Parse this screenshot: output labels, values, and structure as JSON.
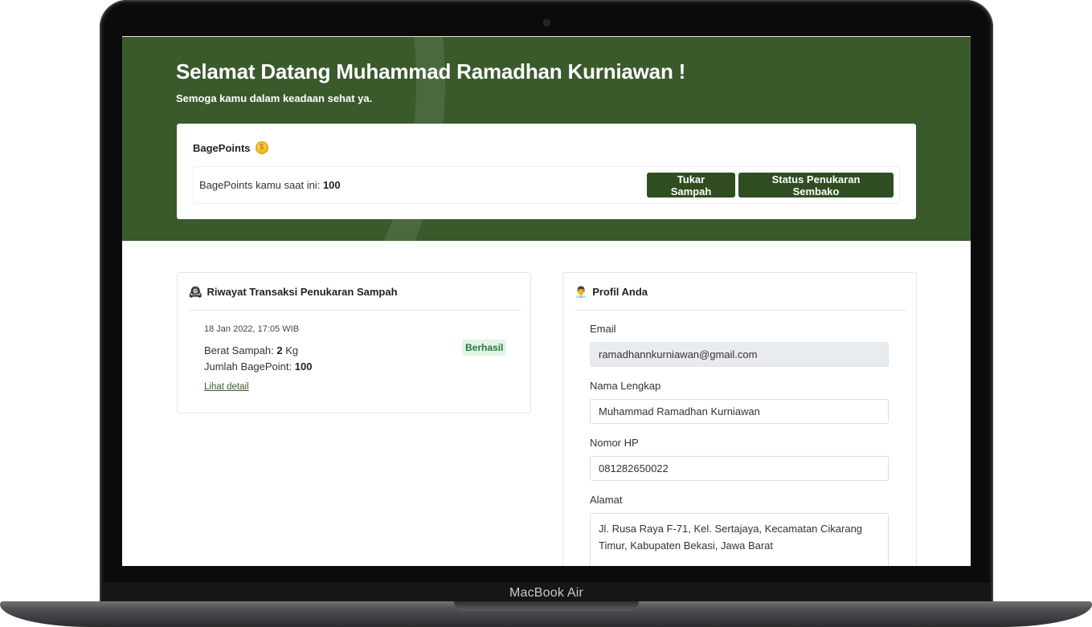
{
  "device": {
    "label": "MacBook Air"
  },
  "hero": {
    "title": "Selamat Datang Muhammad Ramadhan Kurniawan !",
    "subtitle": "Semoga kamu dalam keadaan sehat ya."
  },
  "points": {
    "title": "BagePoints",
    "coin_glyph": "$",
    "label": "BagePoints kamu saat ini:",
    "value": "100",
    "btn_tukar": "Tukar Sampah",
    "btn_status": "Status Penukaran Sembako"
  },
  "riwayat": {
    "icon": "🕰",
    "title": "Riwayat Transaksi Penukaran Sampah",
    "transactions": [
      {
        "date": "18 Jan 2022, 17:05 WIB",
        "weight_label": "Berat Sampah:",
        "weight_value": "2",
        "weight_unit": "Kg",
        "points_label": "Jumlah BagePoint:",
        "points_value": "100",
        "status": "Berhasil",
        "detail_link": "Lihat detail"
      }
    ]
  },
  "profil": {
    "icon": "👨‍💼",
    "title": "Profil Anda",
    "email_label": "Email",
    "email_value": "ramadhannkurniawan@gmail.com",
    "name_label": "Nama Lengkap",
    "name_value": "Muhammad Ramadhan Kurniawan",
    "phone_label": "Nomor HP",
    "phone_value": "081282650022",
    "address_label": "Alamat",
    "address_value": "Jl. Rusa Raya F-71, Kel. Sertajaya, Kecamatan Cikarang Timur, Kabupaten Bekasi, Jawa Barat"
  },
  "colors": {
    "brand_green": "#3a5a2c",
    "button_green": "#2f4d21",
    "success_badge_bg": "#e3f3e6",
    "success_badge_text": "#1f7a35"
  }
}
